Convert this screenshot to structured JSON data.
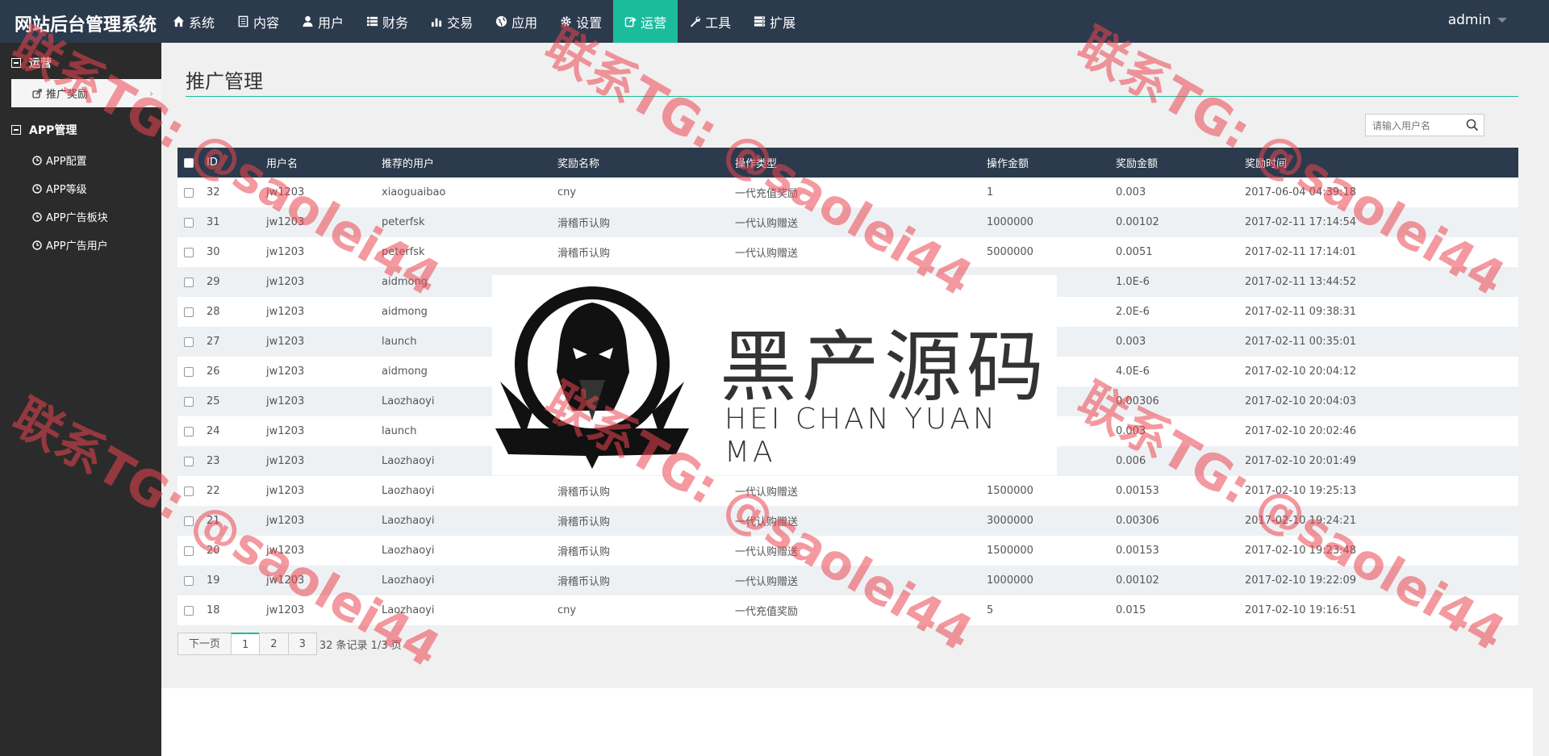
{
  "app": {
    "brand": "网站后台管理系统",
    "user": "admin"
  },
  "nav": [
    {
      "label": "系统",
      "icon": "home-icon"
    },
    {
      "label": "内容",
      "icon": "document-icon"
    },
    {
      "label": "用户",
      "icon": "user-icon"
    },
    {
      "label": "财务",
      "icon": "list-icon"
    },
    {
      "label": "交易",
      "icon": "bar-chart-icon"
    },
    {
      "label": "应用",
      "icon": "globe-icon"
    },
    {
      "label": "设置",
      "icon": "gear-icon"
    },
    {
      "label": "运营",
      "icon": "share-icon",
      "active": true
    },
    {
      "label": "工具",
      "icon": "wrench-icon"
    },
    {
      "label": "扩展",
      "icon": "server-icon"
    }
  ],
  "sidebar": {
    "groups": [
      {
        "title": "运营",
        "items": [
          {
            "label": "推广奖励",
            "active": true
          }
        ]
      },
      {
        "title": "APP管理",
        "items": [
          {
            "label": "APP配置"
          },
          {
            "label": "APP等级"
          },
          {
            "label": "APP广告板块"
          },
          {
            "label": "APP广告用户"
          }
        ]
      }
    ]
  },
  "page": {
    "title": "推广管理",
    "search_placeholder": "请输入用户名"
  },
  "table": {
    "columns": [
      "ID",
      "用户名",
      "推荐的用户",
      "奖励名称",
      "操作类型",
      "操作金额",
      "奖励金额",
      "奖励时间"
    ],
    "rows": [
      [
        "32",
        "jw1203",
        "xiaoguaibao",
        "cny",
        "一代充值奖励",
        "1",
        "0.003",
        "2017-06-04 04:39:18"
      ],
      [
        "31",
        "jw1203",
        "peterfsk",
        "滑稽币认购",
        "一代认购赠送",
        "1000000",
        "0.00102",
        "2017-02-11 17:14:54"
      ],
      [
        "30",
        "jw1203",
        "peterfsk",
        "滑稽币认购",
        "一代认购赠送",
        "5000000",
        "0.0051",
        "2017-02-11 17:14:01"
      ],
      [
        "29",
        "jw1203",
        "aidmong",
        "",
        "",
        "",
        "1.0E-6",
        "2017-02-11 13:44:52"
      ],
      [
        "28",
        "jw1203",
        "aidmong",
        "",
        "",
        "",
        "2.0E-6",
        "2017-02-11 09:38:31"
      ],
      [
        "27",
        "jw1203",
        "launch",
        "",
        "",
        "",
        "0.003",
        "2017-02-11 00:35:01"
      ],
      [
        "26",
        "jw1203",
        "aidmong",
        "",
        "",
        "",
        "4.0E-6",
        "2017-02-10 20:04:12"
      ],
      [
        "25",
        "jw1203",
        "Laozhaoyi",
        "",
        "",
        "",
        "0.00306",
        "2017-02-10 20:04:03"
      ],
      [
        "24",
        "jw1203",
        "launch",
        "",
        "",
        "",
        "0.003",
        "2017-02-10 20:02:46"
      ],
      [
        "23",
        "jw1203",
        "Laozhaoyi",
        "",
        "",
        "",
        "0.006",
        "2017-02-10 20:01:49"
      ],
      [
        "22",
        "jw1203",
        "Laozhaoyi",
        "滑稽币认购",
        "一代认购赠送",
        "1500000",
        "0.00153",
        "2017-02-10 19:25:13"
      ],
      [
        "21",
        "jw1203",
        "Laozhaoyi",
        "滑稽币认购",
        "一代认购赠送",
        "3000000",
        "0.00306",
        "2017-02-10 19:24:21"
      ],
      [
        "20",
        "jw1203",
        "Laozhaoyi",
        "滑稽币认购",
        "一代认购赠送",
        "1500000",
        "0.00153",
        "2017-02-10 19:23:48"
      ],
      [
        "19",
        "jw1203",
        "Laozhaoyi",
        "滑稽币认购",
        "一代认购赠送",
        "1000000",
        "0.00102",
        "2017-02-10 19:22:09"
      ],
      [
        "18",
        "jw1203",
        "Laozhaoyi",
        "cny",
        "一代充值奖励",
        "5",
        "0.015",
        "2017-02-10 19:16:51"
      ]
    ]
  },
  "pager": {
    "prev": "下一页",
    "pages": [
      "1",
      "2",
      "3"
    ],
    "current": "1",
    "info": "32 条记录 1/3 页"
  },
  "overlay": {
    "cn": "黑产源码",
    "en": "HEI CHAN YUAN MA"
  },
  "watermark": {
    "text": "联系TG: @saolei44",
    "color": "#eb4650"
  },
  "colors": {
    "topbar": "#2b3a4c",
    "accent": "#1abc9c",
    "sidebar": "#2b2b2b"
  }
}
